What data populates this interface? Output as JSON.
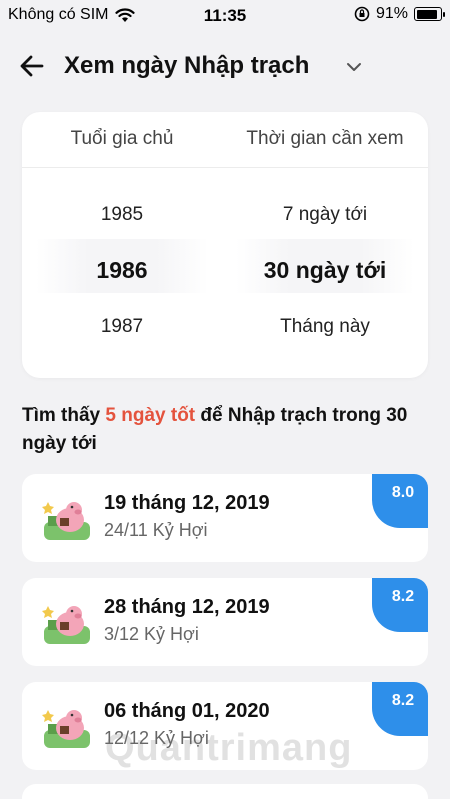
{
  "status_bar": {
    "carrier": "Không có SIM",
    "time": "11:35",
    "battery_percent": "91%",
    "battery_level": 0.91
  },
  "header": {
    "title": "Xem ngày Nhập trạch",
    "back_icon": "arrow-left-icon",
    "dropdown_icon": "chevron-down-icon"
  },
  "picker": {
    "left_header": "Tuổi gia chủ",
    "right_header": "Thời gian cần xem",
    "left_options": [
      "1985",
      "1986",
      "1987"
    ],
    "right_options": [
      "7 ngày tới",
      "30 ngày tới",
      "Tháng này"
    ],
    "selected_left": "1986",
    "selected_right": "30 ngày tới"
  },
  "summary": {
    "prefix": "Tìm thấy ",
    "highlight": "5 ngày tốt",
    "suffix": " để Nhập trạch trong 30 ngày tới",
    "highlight_color": "#e4533d"
  },
  "results": [
    {
      "date": "19 tháng 12, 2019",
      "lunar": "24/11 Kỷ Hợi",
      "score": "8.0"
    },
    {
      "date": "28 tháng 12, 2019",
      "lunar": "3/12 Kỷ Hợi",
      "score": "8.2"
    },
    {
      "date": "06 tháng 01, 2020",
      "lunar": "12/12 Kỷ Hợi",
      "score": "8.2"
    }
  ],
  "colors": {
    "accent_blue": "#2e8fea",
    "background": "#f2f2f4"
  },
  "watermark": "Quantrimang"
}
